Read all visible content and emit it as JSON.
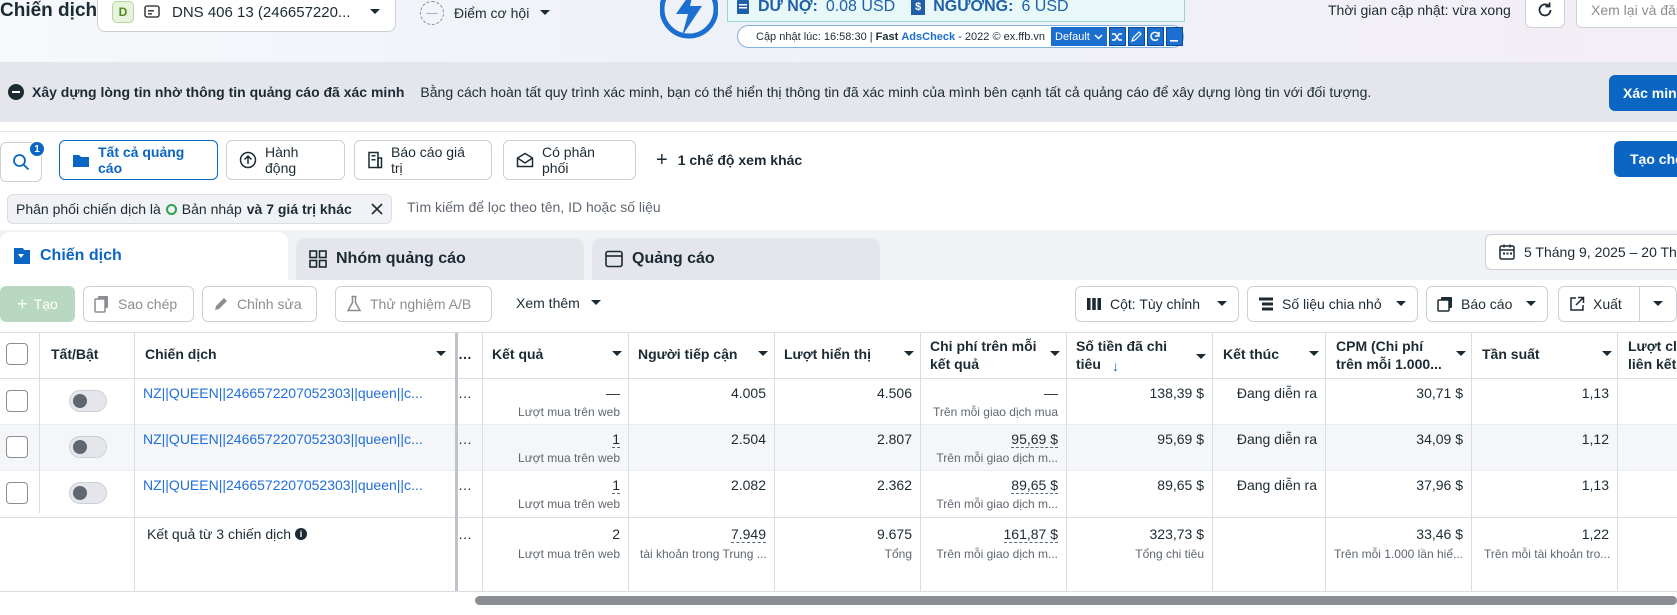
{
  "header": {
    "title": "Chiến dịch",
    "account_badge": "D",
    "account_name": "DNS 406 13 (246657220...",
    "opportunity": "Điểm cơ hội",
    "update_time": "Thời gian cập nhật: vừa xong",
    "review_button": "Xem lại và đăn"
  },
  "ffb": {
    "debt_label": "DƯ NỢ:",
    "debt_value": "0.08 USD",
    "threshold_label": "NGƯỠNG:",
    "threshold_value": "6 USD",
    "update_prefix": "Cập nhật lúc: 16:58:30 | ",
    "brand_fast": "Fast ",
    "brand_ads": "AdsCheck",
    "brand_suffix": " - 2022 © ex.ffb.vn",
    "mode": "Default"
  },
  "banner": {
    "title": "Xây dựng lòng tin nhờ thông tin quảng cáo đã xác minh",
    "text": "Bằng cách hoàn tất quy trình xác minh, bạn có thể hiển thị thông tin đã xác minh của mình bên cạnh tất cả quảng cáo để xây dựng lòng tin với đối tượng.",
    "button": "Xác minh"
  },
  "views": {
    "search_badge": "1",
    "all_ads": "Tất cả quảng cáo",
    "actions": "Hành động",
    "value_report": "Báo cáo giá trị",
    "delivery": "Có phân phối",
    "more_views": "1 chế độ xem khác",
    "create_view": "Tạo chế"
  },
  "filter": {
    "prefix": "Phân phối chiến dịch là",
    "value": "Bản nháp",
    "suffix": "và 7 giá trị khác",
    "search_placeholder": "Tìm kiếm để lọc theo tên, ID hoặc số liệu"
  },
  "tabs": {
    "campaigns": "Chiến dịch",
    "adsets": "Nhóm quảng cáo",
    "ads": "Quảng cáo",
    "date_range": "5 Tháng 9, 2025 – 20 Thá"
  },
  "toolbar": {
    "create": "Tạo",
    "copy": "Sao chép",
    "edit": "Chỉnh sửa",
    "ab_test": "Thử nghiệm A/B",
    "more": "Xem thêm",
    "columns": "Cột: Tùy chỉnh",
    "breakdown": "Số liệu chia nhỏ",
    "reports": "Báo cáo",
    "export": "Xuất"
  },
  "table": {
    "headers": {
      "toggle": "Tất/Bật",
      "campaign": "Chiến dịch",
      "results": "Kết quả",
      "reach": "Người tiếp cận",
      "impressions": "Lượt hiển thị",
      "cpr": "Chi phí trên mỗi kết quả",
      "spent": "Số tiền đã chi tiêu",
      "end": "Kết thúc",
      "cpm": "CPM (Chi phí trên mỗi 1.000...",
      "frequency": "Tần suất",
      "link_clicks": "Lượt cli liên kết"
    },
    "rows": [
      {
        "name": "NZ||QUEEN||2466572207052303||queen||c...",
        "results": "—",
        "results_sub": "Lượt mua trên web",
        "reach": "4.005",
        "impressions": "4.506",
        "cpr": "—",
        "cpr_sub": "Trên mỗi giao dịch mua",
        "spent": "138,39 $",
        "end": "Đang diễn ra",
        "cpm": "30,71 $",
        "frequency": "1,13"
      },
      {
        "name": "NZ||QUEEN||2466572207052303||queen||c...",
        "results": "1",
        "results_sub": "Lượt mua trên web",
        "reach": "2.504",
        "impressions": "2.807",
        "cpr": "95,69 $",
        "cpr_sub": "Trên mỗi giao dịch m...",
        "spent": "95,69 $",
        "end": "Đang diễn ra",
        "cpm": "34,09 $",
        "frequency": "1,12"
      },
      {
        "name": "NZ||QUEEN||2466572207052303||queen||c...",
        "results": "1",
        "results_sub": "Lượt mua trên web",
        "reach": "2.082",
        "impressions": "2.362",
        "cpr": "89,65 $",
        "cpr_sub": "Trên mỗi giao dịch m...",
        "spent": "89,65 $",
        "end": "Đang diễn ra",
        "cpm": "37,96 $",
        "frequency": "1,13"
      }
    ],
    "summary": {
      "label": "Kết quả từ 3 chiến dịch",
      "results": "2",
      "results_sub": "Lượt mua trên web",
      "reach": "7.949",
      "reach_sub": "tài khoản trong Trung ...",
      "impressions": "9.675",
      "impressions_sub": "Tổng",
      "cpr": "161,87 $",
      "cpr_sub": "Trên mỗi giao dịch m...",
      "spent": "323,73 $",
      "spent_sub": "Tổng chi tiêu",
      "cpm": "33,46 $",
      "cpm_sub": "Trên mỗi 1.000 lần hiể...",
      "frequency": "1,22",
      "frequency_sub": "Trên mỗi tài khoản tro..."
    }
  }
}
